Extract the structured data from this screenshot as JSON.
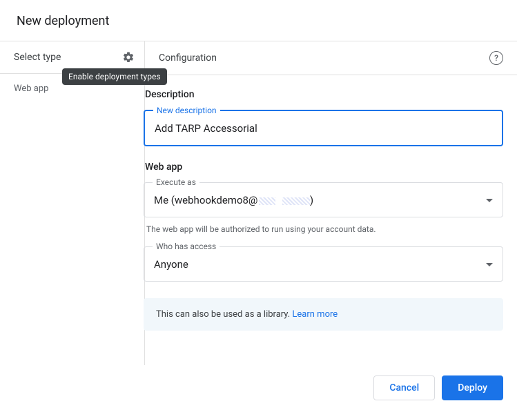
{
  "title": "New deployment",
  "sidebar": {
    "header": "Select type",
    "tooltip": "Enable deployment types",
    "items": [
      "Web app"
    ]
  },
  "main": {
    "header": "Configuration",
    "help_symbol": "?",
    "description": {
      "section_label": "Description",
      "floating_label": "New description",
      "value": "Add TARP Accessorial"
    },
    "webapp": {
      "section_label": "Web app",
      "execute_as": {
        "floating_label": "Execute as",
        "value_prefix": "Me (webhookdemo8@",
        "value_suffix": ")"
      },
      "helper_text": "The web app will be authorized to run using your account data.",
      "access": {
        "floating_label": "Who has access",
        "value": "Anyone"
      }
    },
    "banner": {
      "text": "This can also be used as a library. ",
      "link": "Learn more"
    }
  },
  "footer": {
    "cancel": "Cancel",
    "deploy": "Deploy"
  }
}
